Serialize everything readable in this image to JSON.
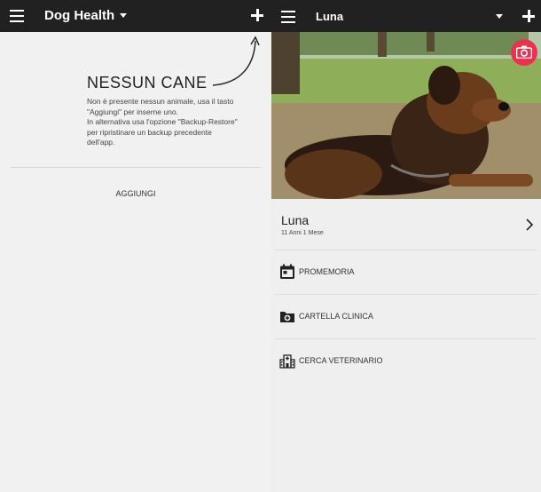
{
  "left": {
    "appbar": {
      "title": "Dog Health"
    },
    "empty_state": {
      "title": "NESSUN CANE",
      "line1": "Non è presente nessun animale, usa il tasto",
      "line2": "\"Aggiungi\" per inserne uno.",
      "line3": "In alternativa usa l'opzione \"Backup-Restore\"",
      "line4": "per ripristinare un backup precedente",
      "line5": "dell'app."
    },
    "add_label": "AGGIUNGI"
  },
  "right": {
    "appbar": {
      "title": "Luna"
    },
    "pet": {
      "name": "Luna",
      "age": "11 Anni 1 Mese"
    },
    "menu": [
      {
        "label": "PROMEMORIA",
        "icon": "calendar-icon"
      },
      {
        "label": "CARTELLA CLINICA",
        "icon": "medical-folder-icon"
      },
      {
        "label": "CERCA VETERINARIO",
        "icon": "hospital-icon"
      }
    ]
  },
  "colors": {
    "appbar": "#212121",
    "background": "#f1f1f1",
    "accent": "#e8334f"
  }
}
